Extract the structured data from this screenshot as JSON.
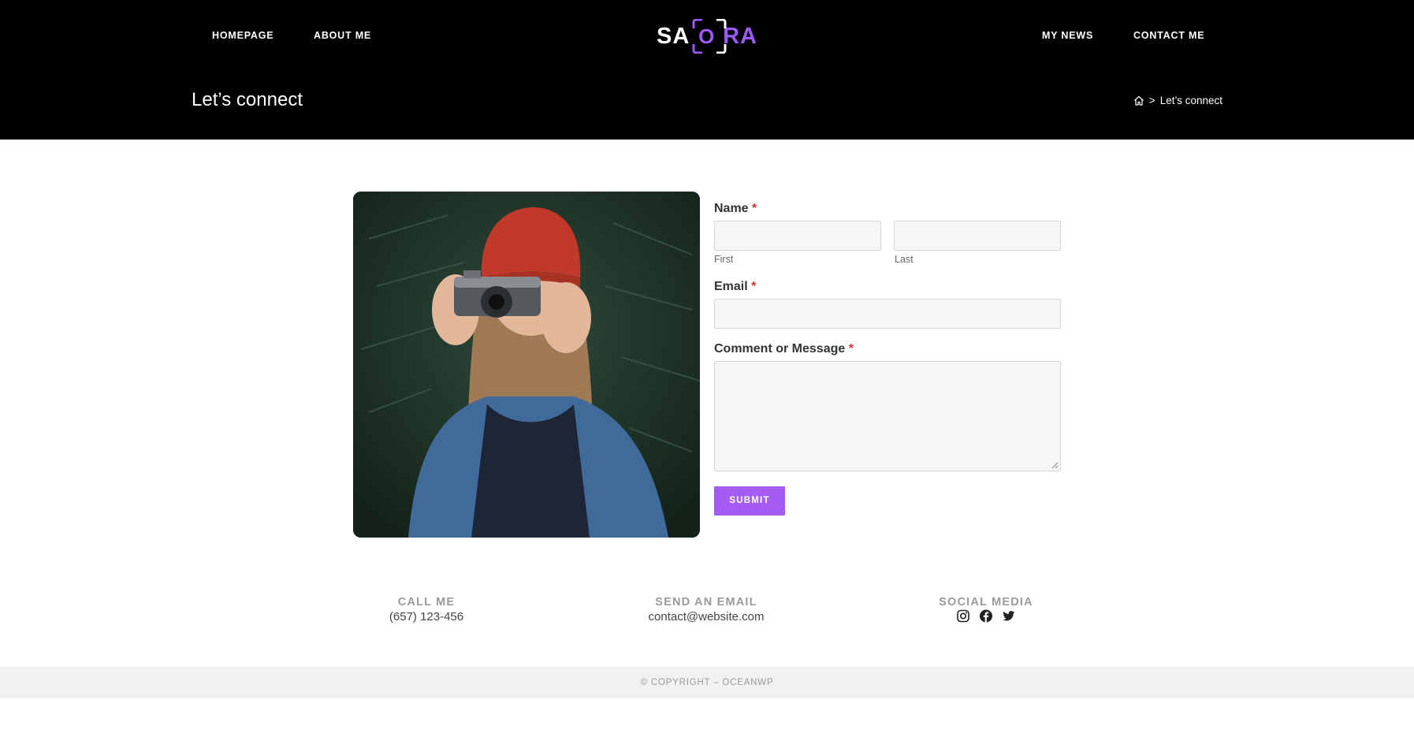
{
  "nav": {
    "left": [
      "HOMEPAGE",
      "ABOUT ME"
    ],
    "right": [
      "MY NEWS",
      "CONTACT ME"
    ]
  },
  "logo": {
    "part1": "SA",
    "middle": "O",
    "part2": "RA"
  },
  "page": {
    "title": "Let’s connect"
  },
  "breadcrumb": {
    "separator": ">",
    "current": "Let’s connect"
  },
  "photo": {
    "icon": "woman-with-camera-photo"
  },
  "form": {
    "name_label": "Name",
    "required_mark": "*",
    "first_label": "First",
    "last_label": "Last",
    "email_label": "Email",
    "message_label": "Comment or Message",
    "first_value": "",
    "last_value": "",
    "email_value": "",
    "message_value": "",
    "submit_label": "SUBMIT"
  },
  "info": {
    "call": {
      "title": "CALL ME",
      "value": "(657) 123-456"
    },
    "email": {
      "title": "SEND AN EMAIL",
      "value": "contact@website.com"
    },
    "social": {
      "title": "SOCIAL MEDIA",
      "icons": [
        "instagram-icon",
        "facebook-icon",
        "twitter-icon"
      ]
    }
  },
  "footer": {
    "copyright": "© COPYRIGHT – OCEANWP"
  },
  "colors": {
    "accent": "#a45cf2",
    "header_bg": "#000000",
    "footer_bg": "#f1f1f1"
  }
}
